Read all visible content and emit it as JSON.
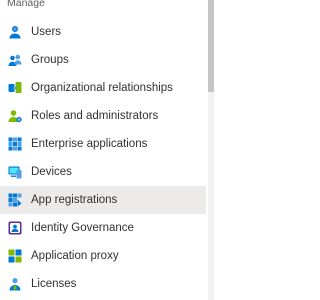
{
  "section": {
    "title": "Manage"
  },
  "nav": {
    "items": [
      {
        "label": "Users",
        "icon": "user-icon"
      },
      {
        "label": "Groups",
        "icon": "group-icon"
      },
      {
        "label": "Organizational relationships",
        "icon": "organizational-relationships-icon"
      },
      {
        "label": "Roles and administrators",
        "icon": "roles-icon"
      },
      {
        "label": "Enterprise applications",
        "icon": "enterprise-applications-icon"
      },
      {
        "label": "Devices",
        "icon": "devices-icon"
      },
      {
        "label": "App registrations",
        "icon": "app-registrations-icon",
        "selected": true
      },
      {
        "label": "Identity Governance",
        "icon": "identity-governance-icon"
      },
      {
        "label": "Application proxy",
        "icon": "application-proxy-icon"
      },
      {
        "label": "Licenses",
        "icon": "licenses-icon"
      }
    ]
  },
  "colors": {
    "accent": "#0078d4",
    "selected_bg": "#edebe9",
    "green": "#7fba00",
    "teal": "#50e6ff"
  }
}
